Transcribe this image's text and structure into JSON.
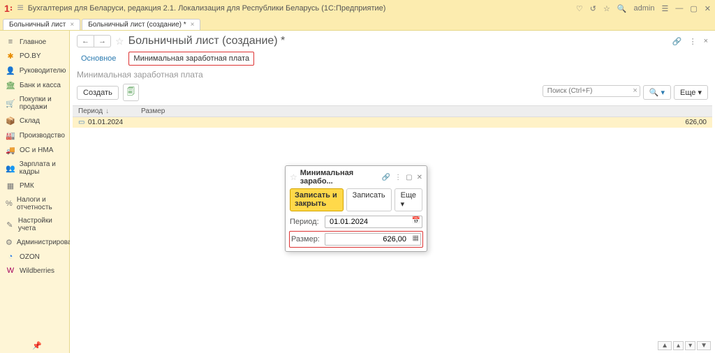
{
  "top": {
    "app_title": "Бухгалтерия для Беларуси, редакция 2.1. Локализация для Республики Беларусь    (1С:Предприятие)",
    "user": "admin"
  },
  "tabs": [
    {
      "label": "Больничный лист"
    },
    {
      "label": "Больничный лист (создание) *"
    }
  ],
  "sidebar": [
    {
      "icon": "≡",
      "label": "Главное",
      "color": "#666"
    },
    {
      "icon": "✱",
      "label": "PO.BY",
      "color": "#e68a00"
    },
    {
      "icon": "👤",
      "label": "Руководителю",
      "color": "#777"
    },
    {
      "icon": "🏛",
      "label": "Банк и касса",
      "color": "#3a8f3a"
    },
    {
      "icon": "🛒",
      "label": "Покупки и продажи",
      "color": "#3a8f3a"
    },
    {
      "icon": "📦",
      "label": "Склад",
      "color": "#777"
    },
    {
      "icon": "🏭",
      "label": "Производство",
      "color": "#777"
    },
    {
      "icon": "🚚",
      "label": "ОС и НМА",
      "color": "#777"
    },
    {
      "icon": "👥",
      "label": "Зарплата и кадры",
      "color": "#777"
    },
    {
      "icon": "▦",
      "label": "РМК",
      "color": "#777"
    },
    {
      "icon": "%",
      "label": "Налоги и отчетность",
      "color": "#777"
    },
    {
      "icon": "✎",
      "label": "Настройки учета",
      "color": "#777"
    },
    {
      "icon": "⚙",
      "label": "Администрирование",
      "color": "#777"
    },
    {
      "icon": "◔",
      "label": "OZON",
      "color": "#1a73e8"
    },
    {
      "icon": "W",
      "label": "Wildberries",
      "color": "#a3005b"
    }
  ],
  "doc": {
    "title": "Больничный лист (создание) *",
    "tab_main": "Основное",
    "tab_minwage": "Минимальная заработная плата",
    "section": "Минимальная заработная плата",
    "create": "Создать",
    "search_ph": "Поиск (Ctrl+F)",
    "more": "Еще",
    "col_period": "Период",
    "col_size": "Размер",
    "row_date": "01.01.2024",
    "row_value": "626,00"
  },
  "dialog": {
    "title": "Минимальная зарабо...",
    "save_close": "Записать и закрыть",
    "save": "Записать",
    "more": "Еще",
    "period_label": "Период:",
    "period_value": "01.01.2024",
    "size_label": "Размер:",
    "size_value": "626,00"
  }
}
